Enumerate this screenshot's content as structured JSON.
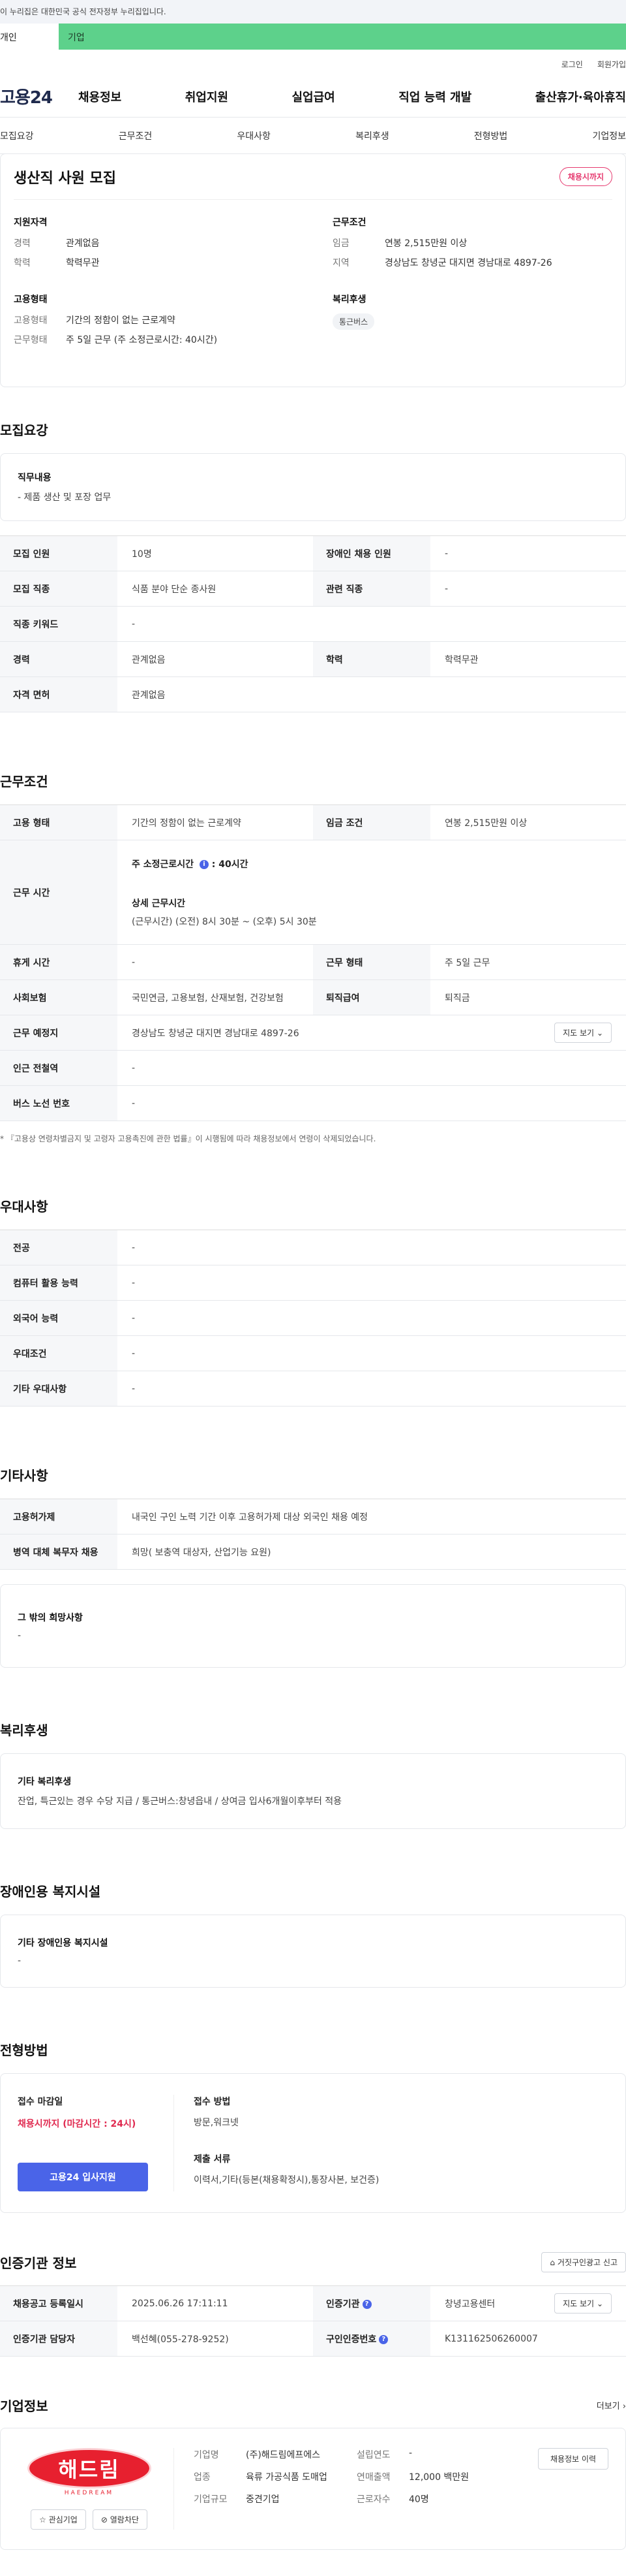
{
  "gov_banner": "이 누리집은 대한민국 공식 전자정부 누리집입니다.",
  "user_tabs": {
    "personal": "개인",
    "company": "기업"
  },
  "util_links": [
    "로그인",
    "회원가입"
  ],
  "logo": "고용24",
  "gnb": [
    "채용정보",
    "취업지원",
    "실업급여",
    "직업 능력 개발",
    "출산휴가·육아휴직"
  ],
  "anchor_tabs": [
    "모집요강",
    "근무조건",
    "우대사항",
    "복리후생",
    "전형방법",
    "기업정보"
  ],
  "job": {
    "title": "생산직 사원 모집",
    "badge": "채용시까지",
    "qualification": {
      "heading": "지원자격",
      "rows": [
        {
          "k": "경력",
          "v": "관계없음"
        },
        {
          "k": "학력",
          "v": "학력무관"
        }
      ]
    },
    "conditions": {
      "heading": "근무조건",
      "rows": [
        {
          "k": "임금",
          "v": "연봉 2,515만원 이상"
        },
        {
          "k": "지역",
          "v": "경상남도 창녕군 대지면 경남대로 4897-26"
        }
      ]
    },
    "employment": {
      "heading": "고용형태",
      "rows": [
        {
          "k": "고용형태",
          "v": "기간의 정함이 없는 근로계약"
        },
        {
          "k": "근무형태",
          "v": "주 5일 근무 (주 소정근로시간: 40시간)"
        }
      ]
    },
    "welfare": {
      "heading": "복리후생",
      "chip": "통근버스"
    }
  },
  "recruit": {
    "title": "모집요강",
    "duty_heading": "직무내용",
    "duty": "- 제품 생산 및 포장 업무",
    "table": {
      "r1": {
        "k1": "모집 인원",
        "v1": "10명",
        "k2": "장애인 채용 인원",
        "v2": "-"
      },
      "r2": {
        "k1": "모집 직종",
        "v1": "식품 분야 단순 종사원",
        "k2": "관련 직종",
        "v2": "-"
      },
      "r3": {
        "k1": "직종 키워드",
        "v1": "-"
      },
      "r4": {
        "k1": "경력",
        "v1": "관계없음",
        "k2": "학력",
        "v2": "학력무관"
      },
      "r5": {
        "k1": "자격 면허",
        "v1": "관계없음"
      }
    }
  },
  "work": {
    "title": "근무조건",
    "r1": {
      "k1": "고용 형태",
      "v1": "기간의 정함이 없는 근로계약",
      "k2": "임금 조건",
      "v2": "연봉 2,515만원 이상"
    },
    "hours": {
      "k": "근무 시간",
      "weekly_label": "주 소정근로시간",
      "weekly_value": ": 40시간",
      "detail_label": "상세 근무시간",
      "detail": "(근무시간) (오전) 8시 30분 ~ (오후) 5시 30분"
    },
    "r3": {
      "k1": "휴게 시간",
      "v1": "-",
      "k2": "근무 형태",
      "v2": "주 5일 근무"
    },
    "r4": {
      "k1": "사회보험",
      "v1": "국민연금, 고용보험, 산재보험, 건강보험",
      "k2": "퇴직급여",
      "v2": "퇴직금"
    },
    "r5": {
      "k1": "근무 예정지",
      "v1": "경상남도 창녕군 대지면 경남대로 4897-26",
      "btn": "지도 보기"
    },
    "r6": {
      "k1": "인근 전철역",
      "v1": "-"
    },
    "r7": {
      "k1": "버스 노선 번호",
      "v1": "-"
    },
    "note": "* 『고용상 연령차별금지 및 고령자 고용촉진에 관한 법률』이 시행됨에 따라 채용정보에서 연령이 삭제되었습니다."
  },
  "pref": {
    "title": "우대사항",
    "rows": [
      {
        "k": "전공",
        "v": "-"
      },
      {
        "k": "컴퓨터 활용 능력",
        "v": "-"
      },
      {
        "k": "외국어 능력",
        "v": "-"
      },
      {
        "k": "우대조건",
        "v": "-"
      },
      {
        "k": "기타 우대사항",
        "v": "-"
      }
    ]
  },
  "etc": {
    "title": "기타사항",
    "rows": [
      {
        "k": "고용허가제",
        "v": "내국인 구인 노력 기간 이후 고용허가제 대상 외국인 채용 예정"
      },
      {
        "k": "병역 대체 복무자 채용",
        "v": "희망( 보충역 대상자, 산업기능 요원)"
      }
    ],
    "other_heading": "그 밖의 희망사항",
    "other": "-"
  },
  "welfare": {
    "title": "복리후생",
    "heading": "기타 복리후생",
    "text": "잔업, 특근있는 경우 수당 지급 / 통근버스:창녕읍내 / 상여금 입사6개월이후부터 적용"
  },
  "disabled": {
    "title": "장애인용 복지시설",
    "heading": "기타 장애인용 복지시설",
    "text": "-"
  },
  "apply": {
    "title": "전형방법",
    "deadline_label": "접수 마감일",
    "deadline": "채용시까지 (마감시간 : 24시)",
    "button": "고용24 입사지원",
    "method_label": "접수 방법",
    "method": "방문,워크넷",
    "docs_label": "제출 서류",
    "docs": "이력서,기타(등본(채용확정시),통장사본, 보건증)"
  },
  "agency": {
    "title": "인증기관 정보",
    "report_btn": "거짓구인광고 신고",
    "r1": {
      "k1": "채용공고 등록일시",
      "v1": "2025.06.26 17:11:11",
      "k2": "인증기관",
      "v2": "창녕고용센터",
      "btn": "지도 보기"
    },
    "r2": {
      "k1": "인증기관 담당자",
      "v1": "백선혜(055-278-9252)",
      "k2": "구인인증번호",
      "v2": "K131162506260007"
    }
  },
  "company": {
    "title": "기업정보",
    "more": "더보기",
    "logo_text": "해드림",
    "logo_sub": "HAEDREAM",
    "btn_interest": "관심기업",
    "btn_block": "열람차단",
    "left_rows": [
      {
        "k": "기업명",
        "v": "(주)해드림에프에스"
      },
      {
        "k": "업종",
        "v": "육류 가공식품 도매업"
      },
      {
        "k": "기업규모",
        "v": "중견기업"
      }
    ],
    "right_rows": [
      {
        "k": "설립연도",
        "v": "-"
      },
      {
        "k": "연매출액",
        "v": "12,000 백만원"
      },
      {
        "k": "근로자수",
        "v": "40명"
      }
    ],
    "jobs_btn": "채용정보 이력"
  }
}
